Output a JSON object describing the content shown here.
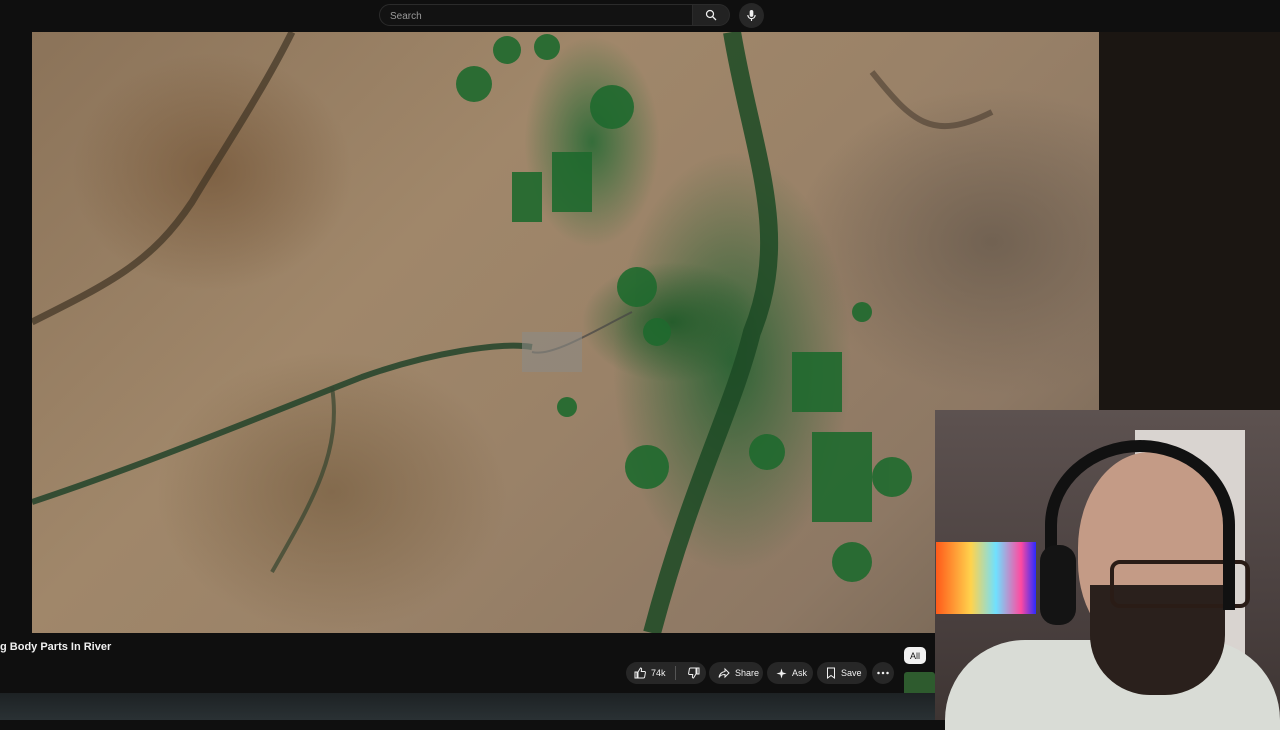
{
  "search": {
    "placeholder": "Search"
  },
  "video": {
    "title": "g Body Parts In River"
  },
  "actions": {
    "like_count": "74k",
    "share_label": "Share",
    "ask_label": "Ask",
    "save_label": "Save"
  },
  "chips": {
    "all_label": "All"
  },
  "icons": {
    "search": "search-icon",
    "mic": "mic-icon",
    "like": "thumbs-up-icon",
    "dislike": "thumbs-down-icon",
    "share": "share-icon",
    "ask": "sparkle-icon",
    "save": "bookmark-icon",
    "more": "more-horizontal-icon"
  },
  "colors": {
    "background": "#0f0f0f",
    "pill": "#272727",
    "text": "#f1f1f1"
  }
}
